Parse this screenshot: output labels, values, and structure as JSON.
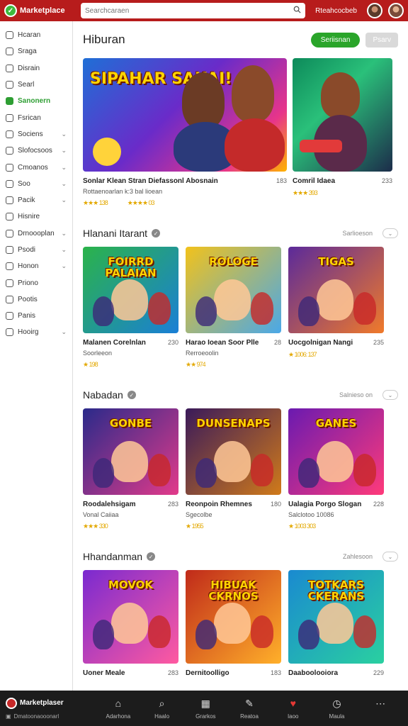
{
  "header": {
    "brand": "Marketplace",
    "search_placeholder": "Searchcaraen",
    "link": "Rteahcocbeb"
  },
  "sidebar": {
    "items": [
      {
        "label": "Hcaran",
        "chev": false,
        "active": false
      },
      {
        "label": "Sraga",
        "chev": false,
        "active": false
      },
      {
        "label": "Disrain",
        "chev": false,
        "active": false
      },
      {
        "label": "Searl",
        "chev": false,
        "active": false
      },
      {
        "label": "Sanonern",
        "chev": false,
        "active": true
      },
      {
        "label": "Fsrican",
        "chev": false,
        "active": false
      },
      {
        "label": "Sociens",
        "chev": true,
        "active": false
      },
      {
        "label": "Slofocsoos",
        "chev": true,
        "active": false
      },
      {
        "label": "Cmoanos",
        "chev": true,
        "active": false
      },
      {
        "label": "Soo",
        "chev": true,
        "active": false
      },
      {
        "label": "Pacik",
        "chev": true,
        "active": false
      },
      {
        "label": "Hisnire",
        "chev": false,
        "active": false
      },
      {
        "label": "Drnoooplan",
        "chev": true,
        "active": false
      },
      {
        "label": "Psodi",
        "chev": true,
        "active": false
      },
      {
        "label": "Honon",
        "chev": true,
        "active": false
      },
      {
        "label": "Priono",
        "chev": false,
        "active": false
      },
      {
        "label": "Pootis",
        "chev": false,
        "active": false
      },
      {
        "label": "Panis",
        "chev": false,
        "active": false
      },
      {
        "label": "Hooirg",
        "chev": true,
        "active": false
      }
    ]
  },
  "hero": {
    "title": "Hiburan",
    "primary_button": "Seriisnan",
    "secondary_button": "Psarv",
    "cards": [
      {
        "art_text": "SIPAHAR SAKAI!",
        "title": "Sonlar Klean Stran Diefassonl Abosnain",
        "num": "183",
        "sub": "Rottaenoarlan k:3 bal lioean",
        "rating1": "★★★ 138",
        "rating2": "★★★★ 03"
      },
      {
        "art_text": "",
        "title": "Comril Idaea",
        "num": "233",
        "sub": "",
        "rating1": "★★★ 393",
        "rating2": ""
      }
    ]
  },
  "sections": [
    {
      "title": "Hlanani Itarant",
      "more": "Sarlioeson",
      "cards": [
        {
          "art_text": "FOIRRD PALAIAN",
          "title": "Malanen Corelnlan",
          "num": "230",
          "sub": "Soorleeon",
          "rating": "★ 198"
        },
        {
          "art_text": "ROLOGE",
          "title": "Harao Ioean Soor Plle",
          "num": "28",
          "sub": "Rerroeoolin",
          "rating": "★★ 974"
        },
        {
          "art_text": "TIGAS",
          "title": "Uocgolnigan Nangi",
          "num": "235",
          "sub": "",
          "rating": "★ 1006: 137"
        }
      ]
    },
    {
      "title": "Nabadan",
      "more": "Salnieso on",
      "cards": [
        {
          "art_text": "GONBE",
          "title": "Roodalehsigam",
          "num": "283",
          "sub": "Vonal Caiiaa",
          "rating": "★★★ 330"
        },
        {
          "art_text": "DUNSENAPS",
          "title": "Reonpoin Rhemnes",
          "num": "180",
          "sub": "Sgecolbe",
          "rating": "★ 1955"
        },
        {
          "art_text": "GANES",
          "title": "Ualagia Porgo Slogan",
          "num": "228",
          "sub": "Salclotoo 10086",
          "rating": "★ 1003 303"
        }
      ]
    },
    {
      "title": "Hhandanman",
      "more": "Zahlesoon",
      "cards": [
        {
          "art_text": "MOVOK",
          "title": "Uoner Meale",
          "num": "283",
          "sub": "",
          "rating": ""
        },
        {
          "art_text": "HIBUAK CKRNOS",
          "title": "Dernitoolligo",
          "num": "183",
          "sub": "",
          "rating": ""
        },
        {
          "art_text": "TOTKARS CKERANS",
          "title": "Daaboolooiora",
          "num": "229",
          "sub": "",
          "rating": ""
        }
      ]
    }
  ],
  "bottom": {
    "brand": "Marketplaser",
    "sub": "Dmatoonaooonarl",
    "items": [
      {
        "label": "Adarhona",
        "icon": "home-icon"
      },
      {
        "label": "Haalo",
        "icon": "search-icon"
      },
      {
        "label": "Grarkos",
        "icon": "calendar-icon"
      },
      {
        "label": "Reatoa",
        "icon": "edit-icon"
      },
      {
        "label": "Iaoo",
        "icon": "heart-icon"
      },
      {
        "label": "Maula",
        "icon": "clock-icon"
      },
      {
        "label": "",
        "icon": "more-icon"
      }
    ]
  }
}
